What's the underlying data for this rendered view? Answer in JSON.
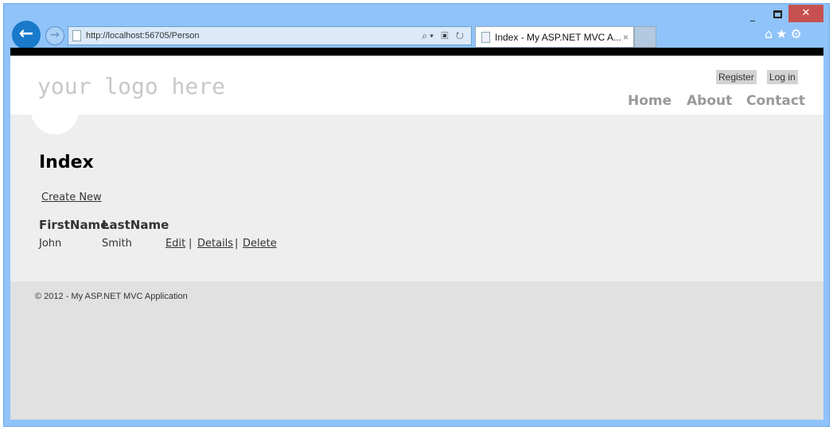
{
  "browser": {
    "url": "http://localhost:56705/Person",
    "tab_title": "Index - My ASP.NET MVC A...",
    "close_tab": "×",
    "minimize": "_",
    "close_window": "✕",
    "icons": [
      "home-icon",
      "star-icon",
      "gear-icon"
    ],
    "back": "←",
    "forward": "→",
    "addr_tools": "⌕▾ ▣ ↻",
    "right_icons": "⌂★⚙"
  },
  "header": {
    "logo": "your logo here",
    "register": "Register",
    "login": "Log in",
    "nav": [
      "Home",
      "About",
      "Contact"
    ]
  },
  "main": {
    "title": "Index",
    "create_new": "Create New",
    "columns": [
      "FirstName",
      "LastName"
    ],
    "rows": [
      {
        "first": "John",
        "last": "Smith",
        "actions": [
          "Edit",
          "Details",
          "Delete"
        ]
      }
    ],
    "separator": "|"
  },
  "footer": {
    "text": "© 2012 - My ASP.NET MVC Application"
  }
}
